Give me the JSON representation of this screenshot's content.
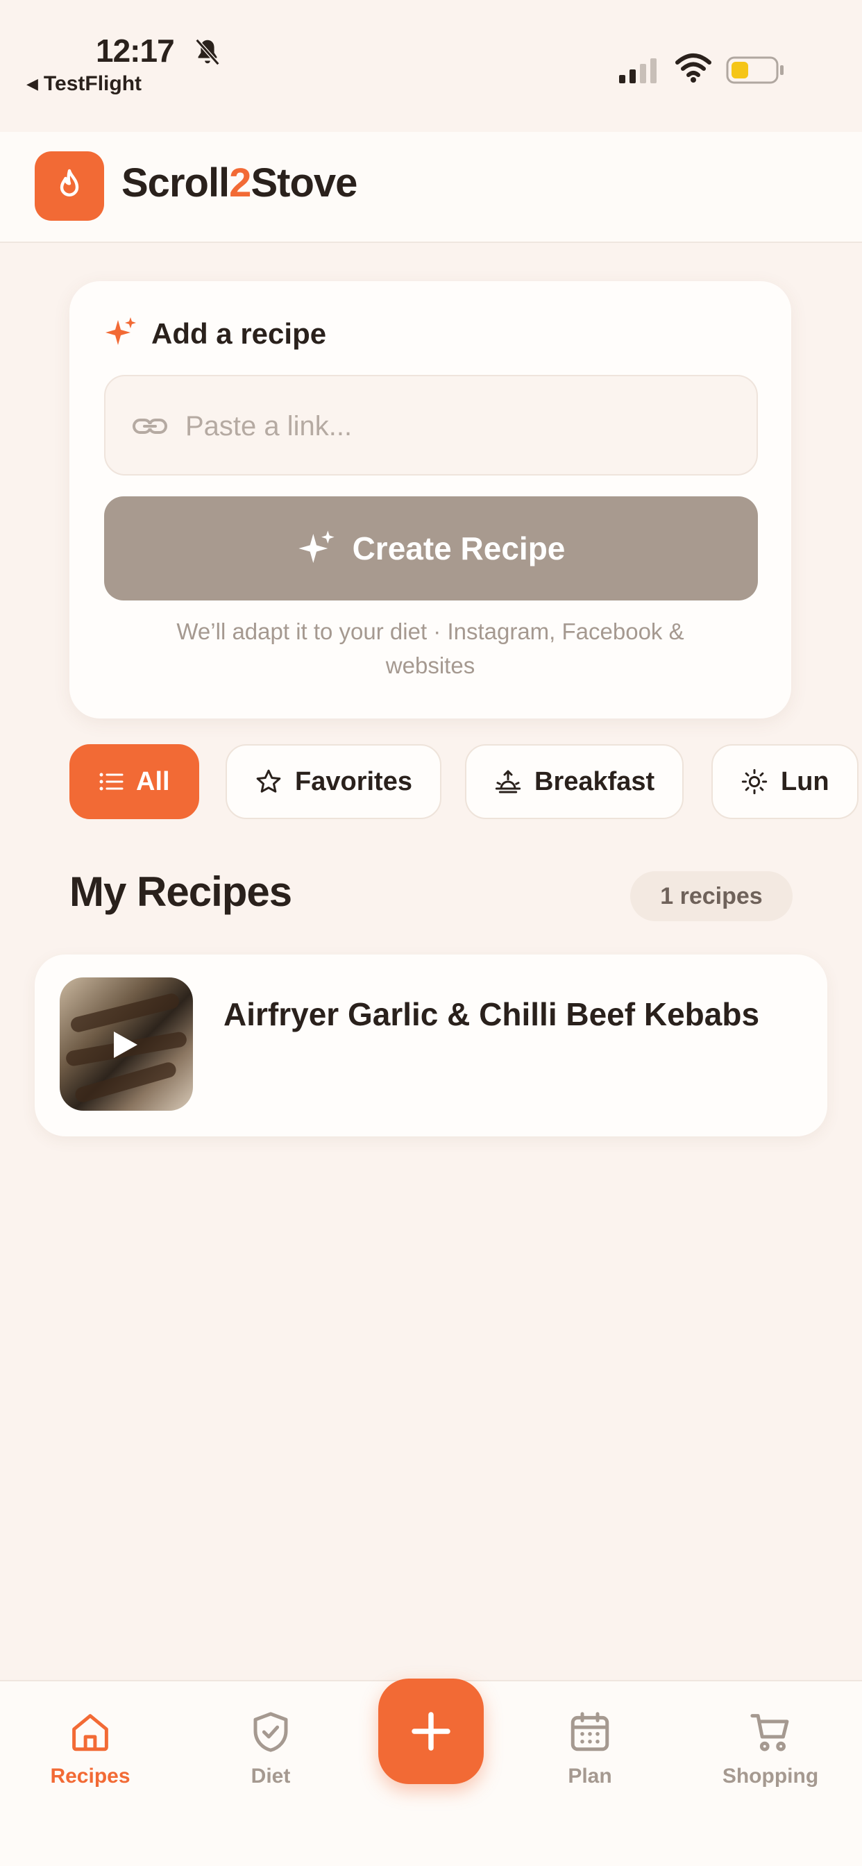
{
  "status_bar": {
    "time": "12:17",
    "back_app": "TestFlight",
    "bell_icon": "bell-slash-icon",
    "signal_icon": "cellular-signal-icon",
    "wifi_icon": "wifi-icon",
    "battery_icon": "battery-low-icon",
    "battery_color": "#f5c518"
  },
  "header": {
    "logo_icon": "flame-icon",
    "brand_prefix": "Scroll",
    "brand_number": "2",
    "brand_suffix": "Stove"
  },
  "add_recipe": {
    "title": "Add a recipe",
    "input_placeholder": "Paste a link...",
    "input_value": "",
    "button_label": "Create Recipe",
    "helper_text": "We’ll adapt it to your diet · Instagram, Facebook & websites"
  },
  "filters": {
    "chips": [
      {
        "label": "All",
        "icon": "list-icon",
        "active": true
      },
      {
        "label": "Favorites",
        "icon": "star-icon",
        "active": false
      },
      {
        "label": "Breakfast",
        "icon": "sunrise-icon",
        "active": false
      },
      {
        "label": "Lun",
        "icon": "sun-icon",
        "active": false
      }
    ]
  },
  "my_recipes": {
    "title": "My Recipes",
    "count_label": "1 recipes",
    "items": [
      {
        "title": "Airfryer Garlic & Chilli Beef Kebabs",
        "thumbnail": "kebab-video-thumbnail"
      }
    ]
  },
  "tabbar": {
    "tabs": [
      {
        "label": "Recipes",
        "icon": "home-icon",
        "active": true
      },
      {
        "label": "Diet",
        "icon": "shield-check-icon",
        "active": false
      },
      {
        "label": "Plan",
        "icon": "calendar-icon",
        "active": false
      },
      {
        "label": "Shopping",
        "icon": "cart-icon",
        "active": false
      }
    ],
    "fab_icon": "plus-icon"
  },
  "colors": {
    "accent": "#f26a35",
    "background": "#fbf3ee",
    "button_disabled": "#a89a8f",
    "muted_text": "#a59990"
  }
}
